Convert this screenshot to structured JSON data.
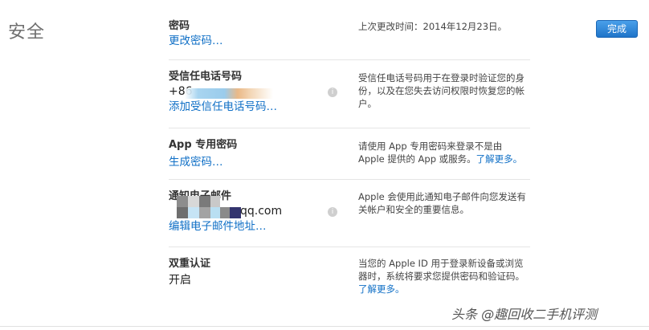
{
  "section": {
    "title": "安全"
  },
  "header": {
    "done_label": "完成"
  },
  "password": {
    "label": "密码",
    "change_link": "更改密码…",
    "description": "上次更改时间：2014年12月23日。"
  },
  "trusted_phone": {
    "label": "受信任电话号码",
    "number_prefix": "+86",
    "add_link": "添加受信任电话号码…",
    "description": "受信任电话号码用于在登录时验证您的身份，以及在您失去访问权限时恢复您的帐户。"
  },
  "app_password": {
    "label": "App 专用密码",
    "generate_link": "生成密码…",
    "description": "请使用 App 专用密码来登录不是由 Apple 提供的 App 或服务。",
    "learn_more": "了解更多。"
  },
  "notification_email": {
    "label": "通知电子邮件",
    "email_suffix": "qq.com",
    "edit_link": "编辑电子邮件地址…",
    "description": "Apple 会使用此通知电子邮件向您发送有关帐户和安全的重要信息。"
  },
  "two_factor": {
    "label": "双重认证",
    "status": "开启",
    "description": "当您的 Apple ID 用于登录新设备或浏览器时，系统将要求您提供密码和验证码。",
    "learn_more": "了解更多。"
  },
  "watermark": {
    "text": "头条 @趣回收二手机评测"
  },
  "colors": {
    "link": "#0f6fc6",
    "button": "#1f74c9",
    "divider": "#e5e5e5"
  }
}
